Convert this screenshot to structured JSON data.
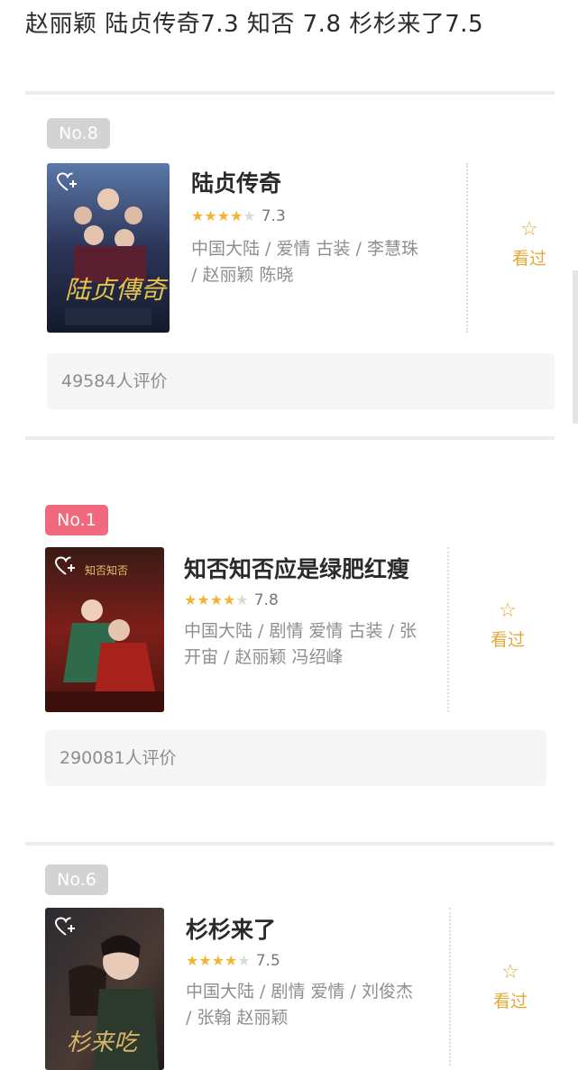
{
  "headline": "赵丽颖 陆贞传奇7.3 知否 7.8 杉杉来了7.5",
  "colors": {
    "star": "#f5b335",
    "seen": "#e2a937",
    "rank_gray": "#d3d3d3",
    "rank_red": "#f0697c"
  },
  "icons": {
    "seen": "star-outline-icon",
    "add": "add-to-list-icon"
  },
  "cards": [
    {
      "rank": "No.8",
      "title": "陆贞传奇",
      "stars": 4,
      "score": "7.3",
      "meta_line1": "中国大陆 / 爱情 古装 / 李慧珠",
      "meta_line2": "/ 赵丽颖 陈晓",
      "seen_label": "看过",
      "ratings": "49584人评价"
    },
    {
      "rank": "No.1",
      "title": "知否知否应是绿肥红瘦",
      "stars": 4,
      "score": "7.8",
      "meta_line1": "中国大陆 / 剧情 爱情 古装 / 张",
      "meta_line2": "开宙 / 赵丽颖 冯绍峰",
      "seen_label": "看过",
      "ratings": "290081人评价"
    },
    {
      "rank": "No.6",
      "title": "杉杉来了",
      "stars": 4,
      "score": "7.5",
      "meta_line1": "中国大陆 / 剧情 爱情 / 刘俊杰",
      "meta_line2": "/ 张翰 赵丽颖",
      "seen_label": "看过",
      "ratings": ""
    }
  ]
}
